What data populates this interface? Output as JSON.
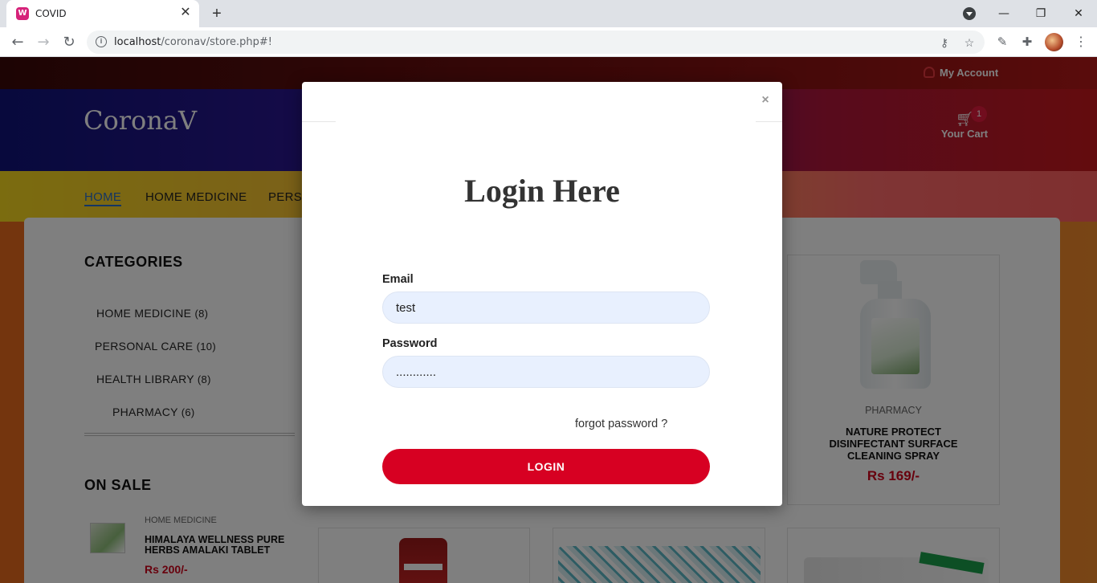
{
  "browser": {
    "tab_title": "COVID",
    "tab_favicon": "W",
    "url_host": "localhost",
    "url_path": "/coronav/store.php#!",
    "icons": [
      "back-icon",
      "forward-icon",
      "reload-icon",
      "info-icon",
      "key-icon",
      "star-icon",
      "eyedropper-icon",
      "puzzle-icon",
      "profile-avatar",
      "more-icon"
    ]
  },
  "site": {
    "brand": "CoronaV",
    "account_label": "My Account",
    "cart_label": "Your Cart",
    "cart_count": "1",
    "nav": [
      "HOME",
      "HOME MEDICINE",
      "PERS"
    ]
  },
  "sidebar": {
    "categories_title": "CATEGORIES",
    "categories": [
      {
        "name": "HOME MEDICINE",
        "count": "(8)"
      },
      {
        "name": "PERSONAL CARE",
        "count": "(10)"
      },
      {
        "name": "HEALTH LIBRARY",
        "count": "(8)"
      },
      {
        "name": "PHARMACY",
        "count": "(6)"
      }
    ],
    "on_sale_title": "ON SALE",
    "sale_item": {
      "category": "HOME MEDICINE",
      "name": "HIMALAYA WELLNESS PURE HERBS AMALAKI TABLET",
      "price": "Rs 200/-"
    }
  },
  "product": {
    "category": "PHARMACY",
    "name": "NATURE PROTECT DISINFECTANT SURFACE CLEANING SPRAY",
    "price": "Rs 169/-"
  },
  "modal": {
    "title": "Login Here",
    "close": "×",
    "email_label": "Email",
    "email_value": "test",
    "password_label": "Password",
    "password_value": "............",
    "forgot": "forgot password ?",
    "login_button": "LOGIN"
  },
  "colors": {
    "primary": "#d70022",
    "accent": "#2a6cc7"
  }
}
